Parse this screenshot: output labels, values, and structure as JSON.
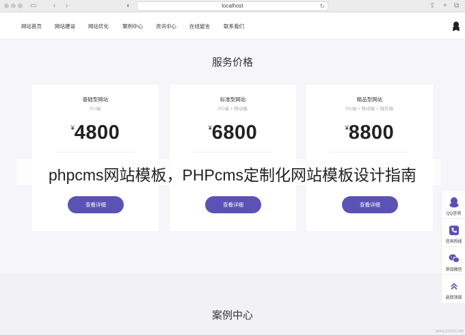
{
  "browser": {
    "url": "localhost"
  },
  "nav": {
    "items": [
      "网站首页",
      "网站建设",
      "网站优化",
      "案例中心",
      "资讯中心",
      "在线留言",
      "联系我们"
    ]
  },
  "pricing": {
    "title": "服务价格",
    "currency": "¥",
    "cards": [
      {
        "title": "基础型网站",
        "sub": "PC端",
        "price": "4800",
        "feature": "",
        "button": "查看详细"
      },
      {
        "title": "标准型网站",
        "sub": "PC端 + 移动端",
        "price": "6800",
        "feature": "",
        "button": "查看详细"
      },
      {
        "title": "精品型网站",
        "sub": "PC端 + 移动端 + 微信端",
        "price": "8800",
        "feature": "",
        "button": "查看详细"
      }
    ]
  },
  "overlay": {
    "headline": "phpcms网站模板，PHPcms定制化网站模板设计指南"
  },
  "cases": {
    "title": "案例中心"
  },
  "side_toolbar": {
    "items": [
      {
        "icon": "qq-icon",
        "label": "QQ咨询"
      },
      {
        "icon": "phone-icon",
        "label": "咨询热线"
      },
      {
        "icon": "wechat-icon",
        "label": "添加微信"
      },
      {
        "icon": "chevron-up-icon",
        "label": "返回顶部"
      }
    ]
  },
  "watermark": "www.zxcms.net",
  "colors": {
    "accent": "#5b52b6",
    "page_bg": "#f6f5f9"
  }
}
